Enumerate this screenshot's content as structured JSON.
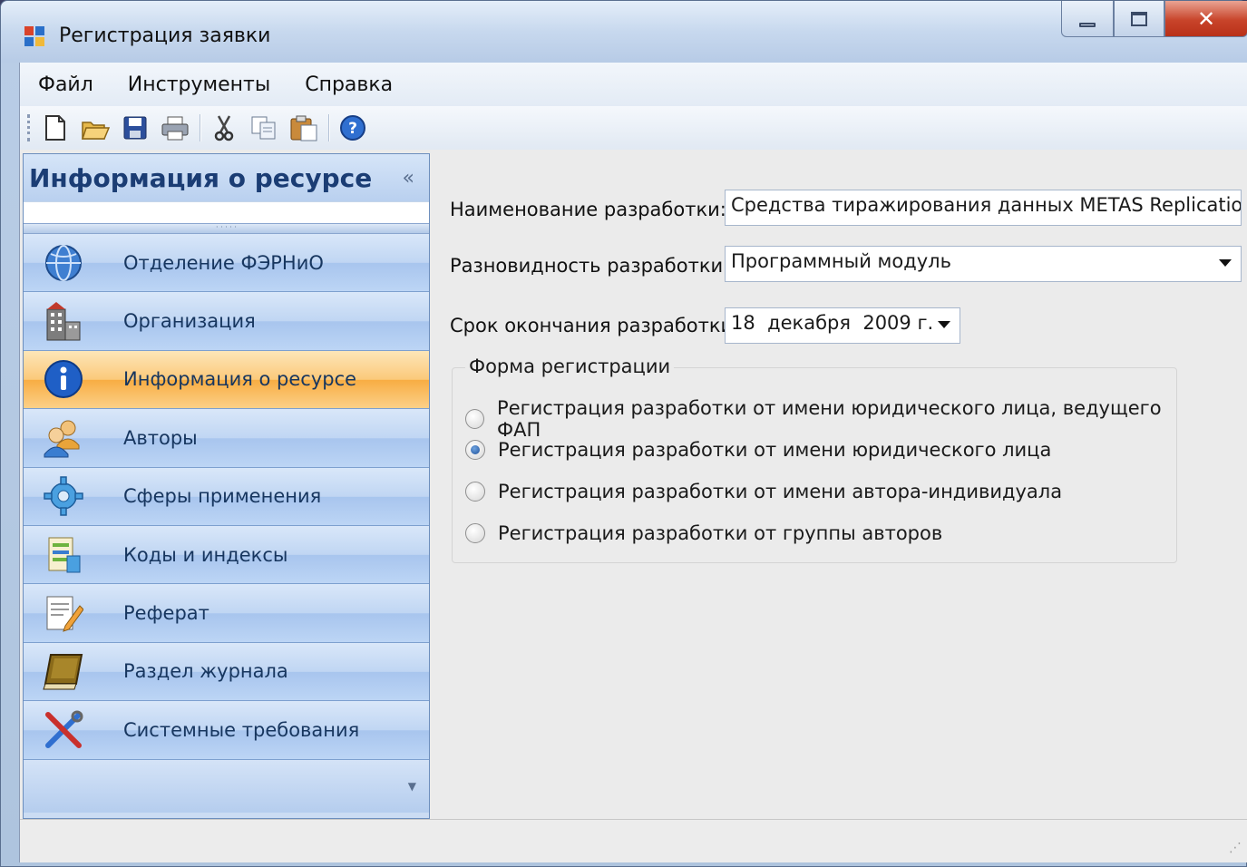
{
  "window": {
    "title": "Регистрация заявки"
  },
  "menu": [
    "Файл",
    "Инструменты",
    "Справка"
  ],
  "toolbar": {
    "buttons": [
      "new-icon",
      "open-icon",
      "save-icon",
      "print-icon",
      "cut-icon",
      "copy-icon",
      "paste-icon",
      "help-icon"
    ]
  },
  "nav": {
    "header": "Информация о ресурсе",
    "items": [
      {
        "label": "Отделение ФЭРНиО",
        "icon": "globe-icon"
      },
      {
        "label": "Организация",
        "icon": "building-icon"
      },
      {
        "label": "Информация о ресурсе",
        "icon": "info-icon",
        "active": true
      },
      {
        "label": "Авторы",
        "icon": "users-icon"
      },
      {
        "label": "Сферы применения",
        "icon": "gear-icon"
      },
      {
        "label": "Коды и индексы",
        "icon": "index-icon"
      },
      {
        "label": "Реферат",
        "icon": "document-edit-icon"
      },
      {
        "label": "Раздел журнала",
        "icon": "book-icon"
      },
      {
        "label": "Системные требования",
        "icon": "tools-icon"
      }
    ]
  },
  "form": {
    "name_label": "Наименование разработки:",
    "name_value": "Средства тиражирования данных METAS Replication",
    "kind_label": "Разновидность разработки:",
    "kind_value": "Программный модуль",
    "deadline_label": "Срок окончания разработки:",
    "deadline_value": "18  декабря  2009 г.",
    "group_title": "Форма регистрации",
    "options": [
      {
        "label": "Регистрация разработки от имени юридического лица, ведущего ФАП",
        "checked": false
      },
      {
        "label": "Регистрация разработки от имени юридического лица",
        "checked": true
      },
      {
        "label": "Регистрация разработки от имени автора-индивидуала",
        "checked": false
      },
      {
        "label": "Регистрация разработки от группы авторов",
        "checked": false
      }
    ]
  },
  "colors": {
    "nav_active": "#f8ad43",
    "nav_bg": "#cbdcf3",
    "header_text": "#1b3d74",
    "close_button": "#c8442a"
  }
}
